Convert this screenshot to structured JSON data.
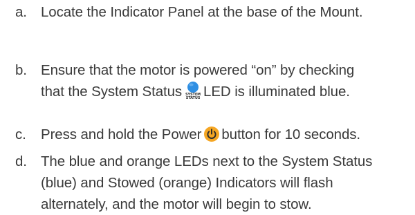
{
  "steps": [
    {
      "marker": "a.",
      "lines": [
        "Locate the Indicator Panel at the base of the Mount."
      ]
    },
    {
      "marker": "b.",
      "line1": "Ensure that the motor is powered “on” by checking",
      "line2_before": "that the System Status",
      "icon": {
        "name": "system-status-led-icon",
        "color": "#2f8fe3",
        "caption_line1": "SYSTEM",
        "caption_line2": "STATUS"
      },
      "line2_after": "LED is illuminated blue."
    },
    {
      "marker": "c.",
      "before": "Press and hold the Power",
      "icon": {
        "name": "power-button-icon",
        "color": "#f5a623"
      },
      "after": "button for 10 seconds."
    },
    {
      "marker": "d.",
      "lines": [
        "The blue and orange LEDs next to the System Status",
        "(blue) and Stowed (orange) Indicators will flash",
        "alternately, and the motor will begin to stow."
      ]
    }
  ]
}
